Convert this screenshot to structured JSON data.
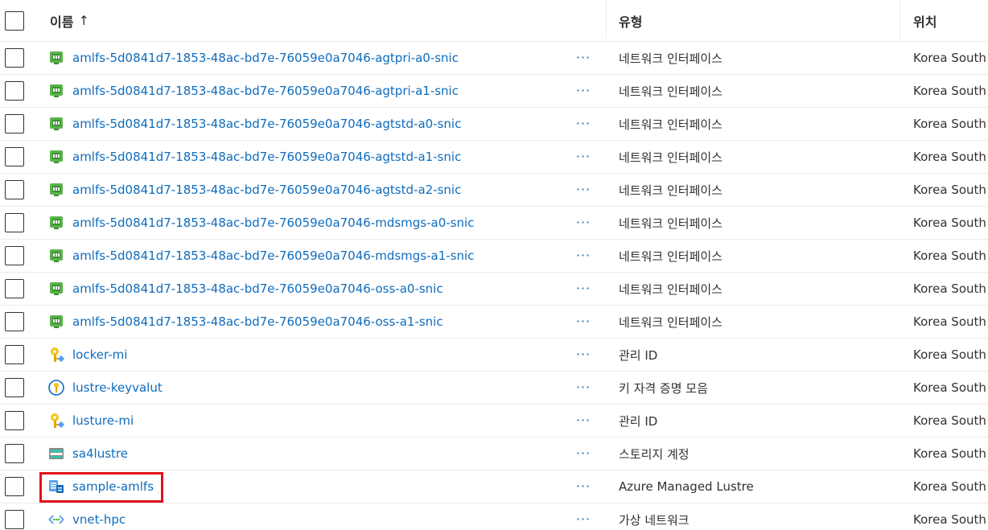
{
  "header": {
    "name_label": "이름",
    "sort_indicator": "↑",
    "type_label": "유형",
    "location_label": "위치"
  },
  "more_label": "···",
  "rows": [
    {
      "name": "amlfs-5d0841d7-1853-48ac-bd7e-76059e0a7046-agtpri-a0-snic",
      "icon": "network-interface-icon",
      "type": "네트워크 인터페이스",
      "location": "Korea South"
    },
    {
      "name": "amlfs-5d0841d7-1853-48ac-bd7e-76059e0a7046-agtpri-a1-snic",
      "icon": "network-interface-icon",
      "type": "네트워크 인터페이스",
      "location": "Korea South"
    },
    {
      "name": "amlfs-5d0841d7-1853-48ac-bd7e-76059e0a7046-agtstd-a0-snic",
      "icon": "network-interface-icon",
      "type": "네트워크 인터페이스",
      "location": "Korea South"
    },
    {
      "name": "amlfs-5d0841d7-1853-48ac-bd7e-76059e0a7046-agtstd-a1-snic",
      "icon": "network-interface-icon",
      "type": "네트워크 인터페이스",
      "location": "Korea South"
    },
    {
      "name": "amlfs-5d0841d7-1853-48ac-bd7e-76059e0a7046-agtstd-a2-snic",
      "icon": "network-interface-icon",
      "type": "네트워크 인터페이스",
      "location": "Korea South"
    },
    {
      "name": "amlfs-5d0841d7-1853-48ac-bd7e-76059e0a7046-mdsmgs-a0-snic",
      "icon": "network-interface-icon",
      "type": "네트워크 인터페이스",
      "location": "Korea South"
    },
    {
      "name": "amlfs-5d0841d7-1853-48ac-bd7e-76059e0a7046-mdsmgs-a1-snic",
      "icon": "network-interface-icon",
      "type": "네트워크 인터페이스",
      "location": "Korea South"
    },
    {
      "name": "amlfs-5d0841d7-1853-48ac-bd7e-76059e0a7046-oss-a0-snic",
      "icon": "network-interface-icon",
      "type": "네트워크 인터페이스",
      "location": "Korea South"
    },
    {
      "name": "amlfs-5d0841d7-1853-48ac-bd7e-76059e0a7046-oss-a1-snic",
      "icon": "network-interface-icon",
      "type": "네트워크 인터페이스",
      "location": "Korea South"
    },
    {
      "name": "locker-mi",
      "icon": "managed-identity-icon",
      "type": "관리 ID",
      "location": "Korea South"
    },
    {
      "name": "lustre-keyvalut",
      "icon": "key-vault-icon",
      "type": "키 자격 증명 모음",
      "location": "Korea South"
    },
    {
      "name": "lusture-mi",
      "icon": "managed-identity-icon",
      "type": "관리 ID",
      "location": "Korea South"
    },
    {
      "name": "sa4lustre",
      "icon": "storage-account-icon",
      "type": "스토리지 계정",
      "location": "Korea South"
    },
    {
      "name": "sample-amlfs",
      "icon": "managed-lustre-icon",
      "type": "Azure Managed Lustre",
      "location": "Korea South"
    },
    {
      "name": "vnet-hpc",
      "icon": "virtual-network-icon",
      "type": "가상 네트워크",
      "location": "Korea South"
    }
  ],
  "colors": {
    "link": "#0f6cbd",
    "highlight": "#e3101a",
    "nic_green": "#59b34a",
    "key_yellow": "#f5c518"
  }
}
